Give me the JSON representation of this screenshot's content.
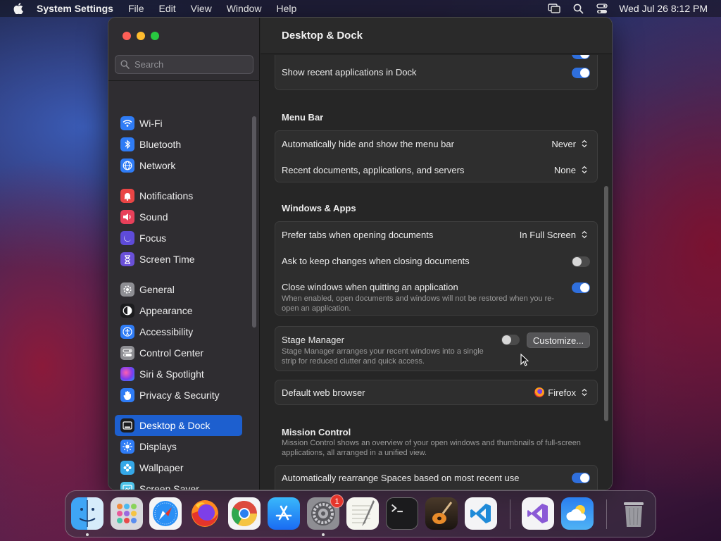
{
  "menubar": {
    "app_name": "System Settings",
    "items": [
      "File",
      "Edit",
      "View",
      "Window",
      "Help"
    ],
    "clock": "Wed Jul 26  8:12 PM"
  },
  "sidebar": {
    "search_placeholder": "Search",
    "items": [
      {
        "label": "Wi-Fi",
        "icon": "wifi-icon",
        "color": "#2f7cf6"
      },
      {
        "label": "Bluetooth",
        "icon": "bluetooth-icon",
        "color": "#2f7cf6"
      },
      {
        "label": "Network",
        "icon": "globe-icon",
        "color": "#2f7cf6"
      },
      {
        "label": "Notifications",
        "icon": "bell-icon",
        "color": "#ea4545"
      },
      {
        "label": "Sound",
        "icon": "speaker-icon",
        "color": "#e8405a"
      },
      {
        "label": "Focus",
        "icon": "moon-icon",
        "color": "#5e4bd8"
      },
      {
        "label": "Screen Time",
        "icon": "hourglass-icon",
        "color": "#6a50d8"
      },
      {
        "label": "General",
        "icon": "gear-icon",
        "color": "#8e8e93"
      },
      {
        "label": "Appearance",
        "icon": "appearance-icon",
        "color": "#1c1c1e"
      },
      {
        "label": "Accessibility",
        "icon": "accessibility-icon",
        "color": "#2f7cf6"
      },
      {
        "label": "Control Center",
        "icon": "control-center-icon",
        "color": "#8e8e93"
      },
      {
        "label": "Siri & Spotlight",
        "icon": "siri-icon",
        "color": "#c23ae0"
      },
      {
        "label": "Privacy & Security",
        "icon": "hand-icon",
        "color": "#2f7cf6"
      },
      {
        "label": "Desktop & Dock",
        "icon": "dock-icon",
        "color": "#1c1c1e"
      },
      {
        "label": "Displays",
        "icon": "sun-icon",
        "color": "#2f7cf6"
      },
      {
        "label": "Wallpaper",
        "icon": "flower-icon",
        "color": "#35a8e8"
      },
      {
        "label": "Screen Saver",
        "icon": "screensaver-icon",
        "color": "#4dc3e8"
      }
    ]
  },
  "main": {
    "title": "Desktop & Dock",
    "dock_group": {
      "show_recent_label": "Show recent applications in Dock",
      "show_recent_on": true
    },
    "menu_bar": {
      "title": "Menu Bar",
      "auto_hide_label": "Automatically hide and show the menu bar",
      "auto_hide_value": "Never",
      "recent_docs_label": "Recent documents, applications, and servers",
      "recent_docs_value": "None"
    },
    "windows_apps": {
      "title": "Windows & Apps",
      "prefer_tabs_label": "Prefer tabs when opening documents",
      "prefer_tabs_value": "In Full Screen",
      "ask_keep_label": "Ask to keep changes when closing documents",
      "ask_keep_on": false,
      "close_windows_label": "Close windows when quitting an application",
      "close_windows_desc": "When enabled, open documents and windows will not be restored when you re-open an application.",
      "close_windows_on": true,
      "stage_manager_label": "Stage Manager",
      "stage_manager_desc": "Stage Manager arranges your recent windows into a single strip for reduced clutter and quick access.",
      "stage_manager_on": false,
      "customize_label": "Customize...",
      "default_browser_label": "Default web browser",
      "default_browser_value": "Firefox"
    },
    "mission_control": {
      "title": "Mission Control",
      "desc": "Mission Control shows an overview of your open windows and thumbnails of full-screen applications, all arranged in a unified view.",
      "rearrange_label": "Automatically rearrange Spaces based on most recent use",
      "rearrange_on": true
    }
  },
  "dock": {
    "apps": [
      {
        "name": "Finder",
        "icon": "finder-icon",
        "running": true
      },
      {
        "name": "Launchpad",
        "icon": "launchpad-icon",
        "running": false
      },
      {
        "name": "Safari",
        "icon": "safari-icon",
        "running": false
      },
      {
        "name": "Firefox",
        "icon": "firefox-icon",
        "running": false
      },
      {
        "name": "Chrome",
        "icon": "chrome-icon",
        "running": false
      },
      {
        "name": "App Store",
        "icon": "app-store-icon",
        "running": false
      },
      {
        "name": "System Settings",
        "icon": "system-settings-icon",
        "running": true,
        "badge": "1"
      },
      {
        "name": "TextEdit",
        "icon": "textedit-icon",
        "running": false
      },
      {
        "name": "Terminal",
        "icon": "terminal-icon",
        "running": false
      },
      {
        "name": "GarageBand",
        "icon": "garageband-icon",
        "running": false
      },
      {
        "name": "Visual Studio Code",
        "icon": "vscode-icon",
        "running": false
      },
      {
        "name": "Visual Studio",
        "icon": "visual-studio-icon",
        "running": false
      },
      {
        "name": "Weather",
        "icon": "weather-icon",
        "running": false
      },
      {
        "name": "Trash",
        "icon": "trash-icon",
        "running": false
      }
    ]
  }
}
